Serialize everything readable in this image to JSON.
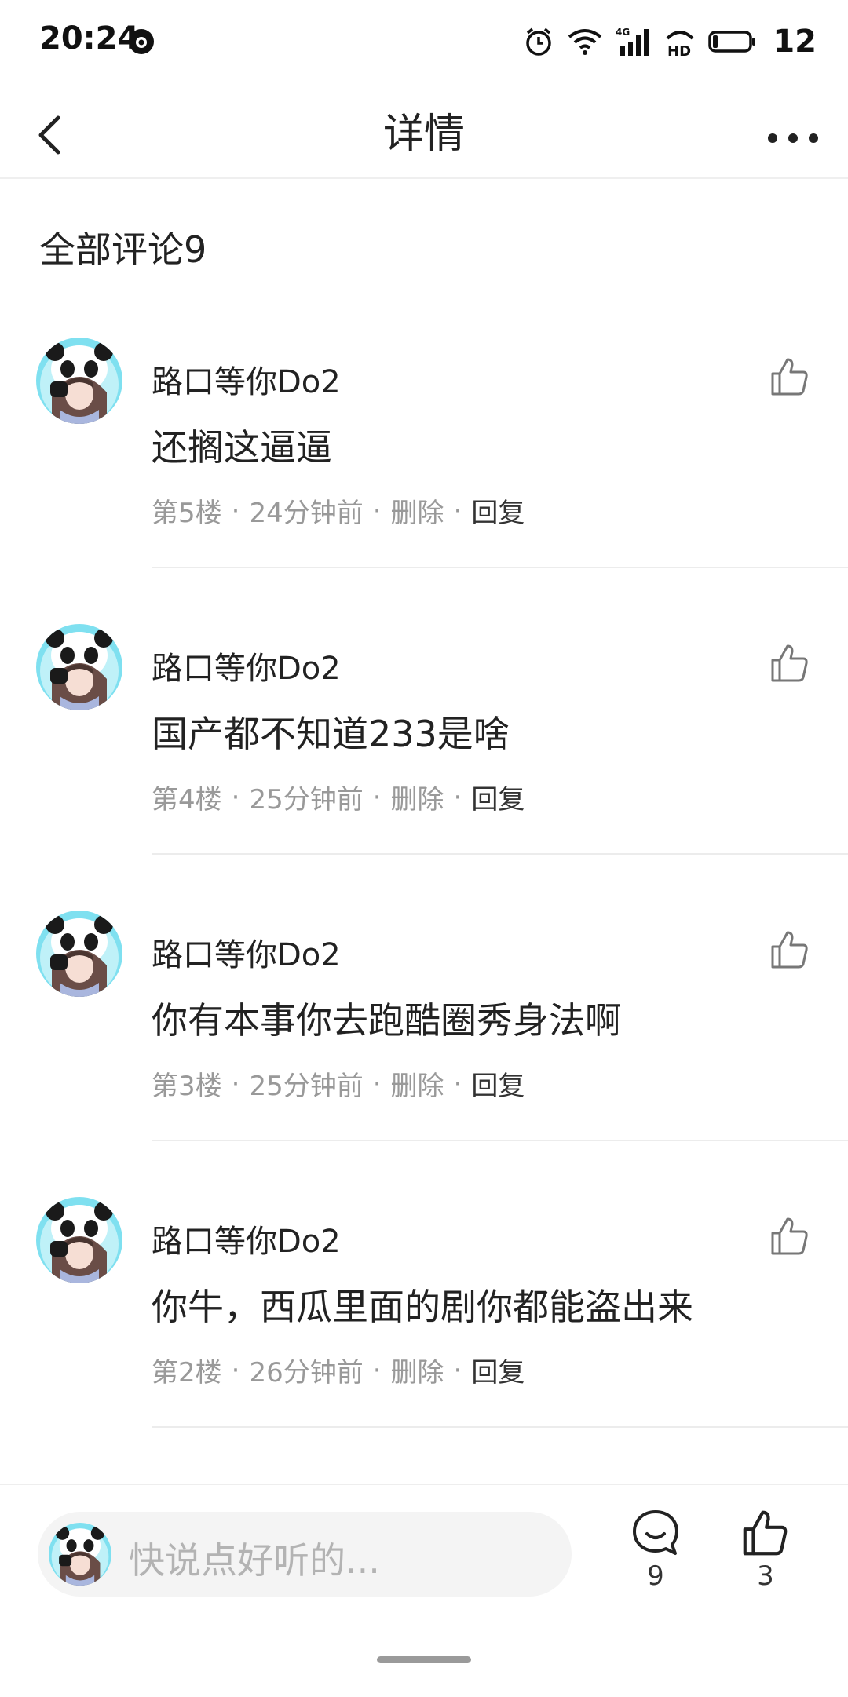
{
  "status_bar": {
    "time": "20:24",
    "battery": "12",
    "network_label": "4G",
    "hd_label": "HD"
  },
  "nav": {
    "title": "详情",
    "back_icon": "chevron-left-icon",
    "more_icon": "more-horizontal-icon"
  },
  "section": {
    "title": "全部评论9"
  },
  "comments": [
    {
      "author": "路口等你Do2",
      "text": "还搁这逼逼",
      "floor": "第5楼",
      "time": "24分钟前",
      "delete": "删除",
      "reply": "回复"
    },
    {
      "author": "路口等你Do2",
      "text": "国产都不知道233是啥",
      "floor": "第4楼",
      "time": "25分钟前",
      "delete": "删除",
      "reply": "回复"
    },
    {
      "author": "路口等你Do2",
      "text": "你有本事你去跑酷圈秀身法啊",
      "floor": "第3楼",
      "time": "25分钟前",
      "delete": "删除",
      "reply": "回复"
    },
    {
      "author": "路口等你Do2",
      "text": "你牛，西瓜里面的剧你都能盗出来",
      "floor": "第2楼",
      "time": "26分钟前",
      "delete": "删除",
      "reply": "回复"
    }
  ],
  "meta_separator": "·",
  "bottom_bar": {
    "input_placeholder": "快说点好听的...",
    "comment_count": "9",
    "like_count": "3"
  },
  "colors": {
    "text_primary": "#222222",
    "text_secondary": "#999999",
    "input_bg": "#f4f4f4",
    "avatar_accent": "#5fd0e6"
  }
}
